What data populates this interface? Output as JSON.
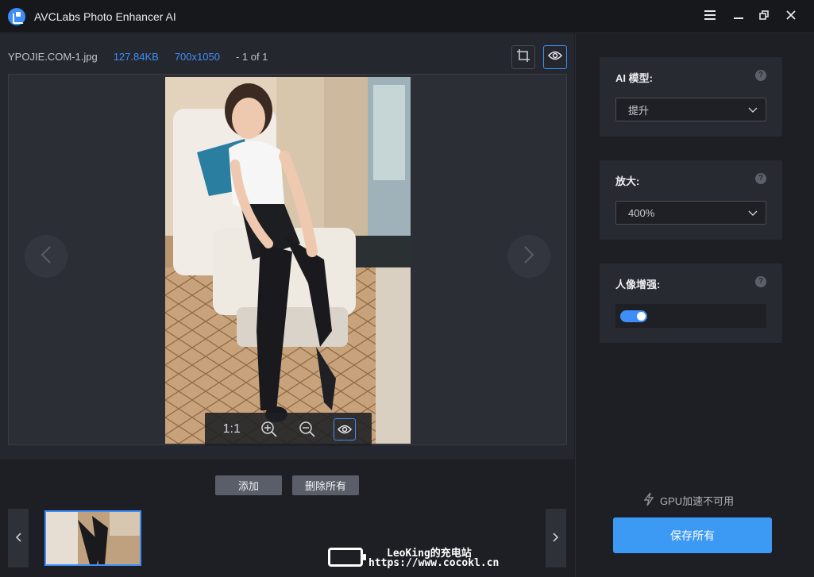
{
  "window": {
    "title": "AVCLabs Photo Enhancer AI",
    "controls": [
      "menu-icon",
      "minimize-icon",
      "restore-icon",
      "close-icon"
    ]
  },
  "file_info": {
    "name": "YPOJIE.COM-1.jpg",
    "size": "127.84KB",
    "dimensions": "700x1050",
    "count": "- 1 of 1"
  },
  "zoom_bar": {
    "ratio_label": "1:1"
  },
  "actions": {
    "add_label": "添加",
    "delete_all_label": "删除所有"
  },
  "settings": {
    "ai_model": {
      "label": "AI 模型:",
      "value": "提升"
    },
    "upscale": {
      "label": "放大:",
      "value": "400%"
    },
    "face_enhance": {
      "label": "人像增强:",
      "enabled": true
    },
    "help_glyph": "?"
  },
  "gpu_status": "GPU加速不可用",
  "save_all_label": "保存所有",
  "watermark": {
    "line1": "LeoKing的充电站",
    "line2": "https://www.cocokl.cn"
  },
  "colors": {
    "accent": "#3d8ef8",
    "background": "#1e1f24",
    "panel": "#282a31"
  }
}
